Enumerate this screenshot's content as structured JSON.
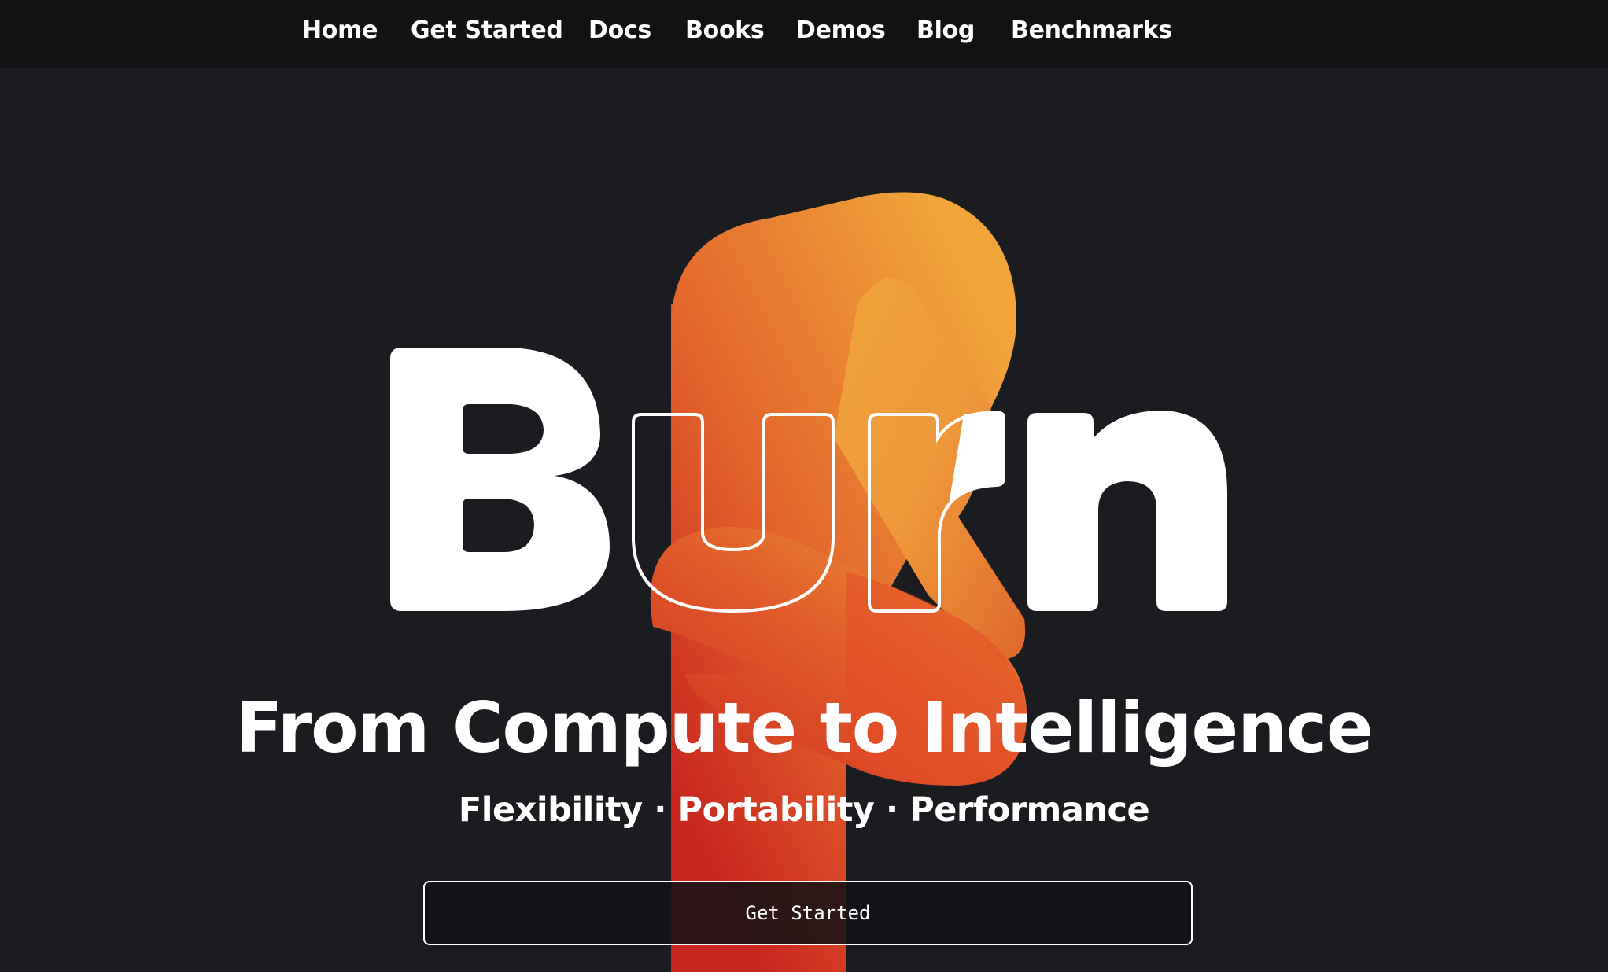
{
  "nav": {
    "items": [
      {
        "label": "Home"
      },
      {
        "label": "Get Started"
      },
      {
        "label": "Docs"
      },
      {
        "label": "Books"
      },
      {
        "label": "Demos"
      },
      {
        "label": "Blog"
      },
      {
        "label": "Benchmarks"
      }
    ]
  },
  "hero": {
    "logo_text": "Burn",
    "logo_icon": "flame-knot-icon",
    "tagline": "From Compute to Intelligence",
    "subtagline": {
      "part1": "Flexibility",
      "sep1": " · ",
      "part2": "Portability",
      "sep2": " · ",
      "part3": "Performance"
    },
    "cta_label": "Get Started"
  },
  "colors": {
    "background": "#1b1c20",
    "navbar": "#111214",
    "flame_light": "#f0a43a",
    "flame_dark": "#c9261f",
    "text": "#ffffff"
  }
}
